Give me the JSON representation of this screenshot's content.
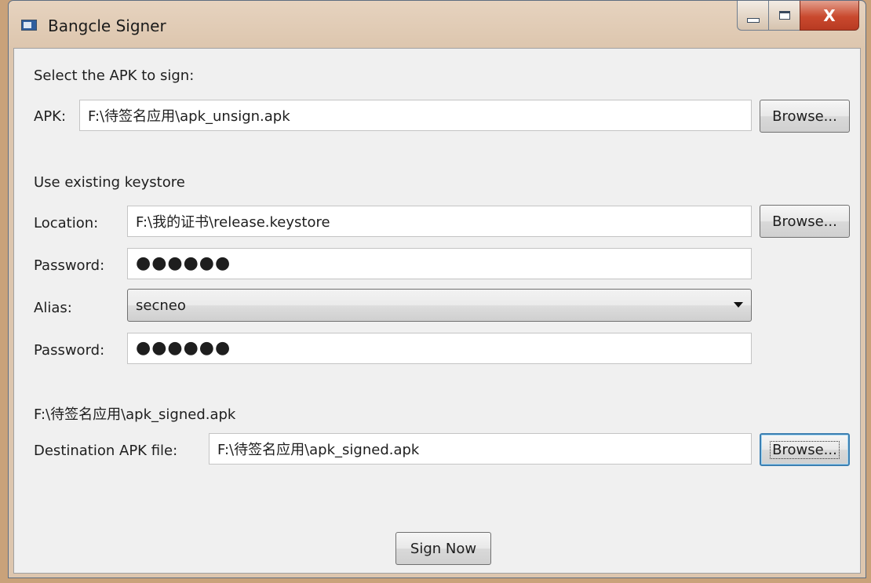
{
  "window": {
    "title": "Bangcle Signer",
    "icons": {
      "app": "app-window-icon",
      "minimize": "minimize-icon",
      "maximize": "maximize-icon",
      "close": "close-icon"
    },
    "close_glyph": "X"
  },
  "apk_section": {
    "heading": "Select the APK to sign:",
    "label": "APK:",
    "value": "F:\\待签名应用\\apk_unsign.apk",
    "browse_label": "Browse..."
  },
  "keystore_section": {
    "heading": "Use existing keystore",
    "location_label": "Location:",
    "location_value": "F:\\我的证书\\release.keystore",
    "location_browse_label": "Browse...",
    "password_label": "Password:",
    "password_mask": "●●●●●●",
    "alias_label": "Alias:",
    "alias_value": "secneo",
    "alias_password_label": "Password:",
    "alias_password_mask": "●●●●●●"
  },
  "destination_section": {
    "path_display": "F:\\待签名应用\\apk_signed.apk",
    "label": "Destination APK file:",
    "value": "F:\\待签名应用\\apk_signed.apk",
    "browse_label": "Browse..."
  },
  "actions": {
    "sign_label": "Sign Now"
  },
  "colors": {
    "focus_border": "#3c7fb1",
    "close_button": "#c9492e"
  }
}
